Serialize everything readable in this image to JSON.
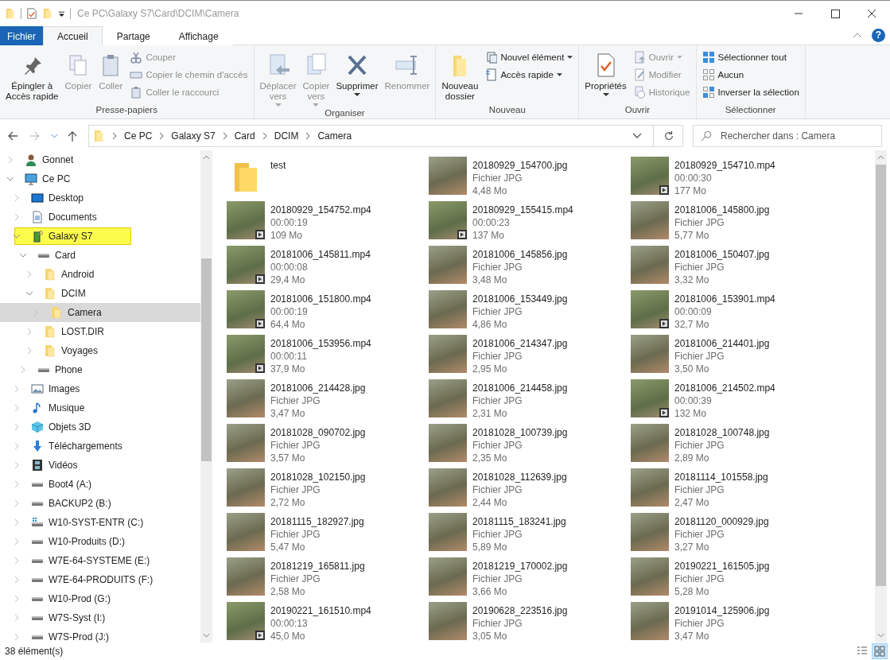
{
  "title_bar": {
    "path": "Ce PC\\Galaxy S7\\Card\\DCIM\\Camera"
  },
  "ribbon_tabs": [
    {
      "label": "Fichier",
      "kind": "file",
      "selected": false
    },
    {
      "label": "Accueil",
      "kind": "tab",
      "selected": true
    },
    {
      "label": "Partage",
      "kind": "tab",
      "selected": false
    },
    {
      "label": "Affichage",
      "kind": "tab",
      "selected": false
    }
  ],
  "help_button": "?",
  "ribbon_groups": [
    {
      "label": "Presse-papiers",
      "items": [
        {
          "label": "Épingler à\nAccès rapide",
          "kind": "large",
          "disabled": false,
          "dropdown": false
        },
        {
          "label": "Copier",
          "kind": "large",
          "disabled": true,
          "dropdown": false
        },
        {
          "label": "Coller",
          "kind": "large",
          "disabled": true,
          "dropdown": false
        },
        {
          "label": "Couper",
          "kind": "small",
          "disabled": true,
          "dropdown": false
        },
        {
          "label": "Copier le chemin d'accès",
          "kind": "small",
          "disabled": true,
          "dropdown": false
        },
        {
          "label": "Coller le raccourci",
          "kind": "small",
          "disabled": true,
          "dropdown": false
        }
      ]
    },
    {
      "label": "Organiser",
      "items": [
        {
          "label": "Déplacer\nvers",
          "kind": "large",
          "disabled": true,
          "dropdown": true
        },
        {
          "label": "Copier\nvers",
          "kind": "large",
          "disabled": true,
          "dropdown": true
        },
        {
          "label": "Supprimer",
          "kind": "large",
          "disabled": false,
          "dropdown": true
        },
        {
          "label": "Renommer",
          "kind": "large",
          "disabled": true,
          "dropdown": false
        }
      ]
    },
    {
      "label": "Nouveau",
      "items": [
        {
          "label": "Nouveau\ndossier",
          "kind": "large",
          "disabled": false,
          "dropdown": false
        },
        {
          "label": "Nouvel élément",
          "kind": "small",
          "disabled": false,
          "dropdown": true
        },
        {
          "label": "Accès rapide",
          "kind": "small",
          "disabled": false,
          "dropdown": true
        }
      ]
    },
    {
      "label": "Ouvrir",
      "items": [
        {
          "label": "Propriétés",
          "kind": "large",
          "disabled": false,
          "dropdown": true
        },
        {
          "label": "Ouvrir",
          "kind": "small",
          "disabled": true,
          "dropdown": true
        },
        {
          "label": "Modifier",
          "kind": "small",
          "disabled": true,
          "dropdown": false
        },
        {
          "label": "Historique",
          "kind": "small",
          "disabled": true,
          "dropdown": false
        }
      ]
    },
    {
      "label": "Sélectionner",
      "items": [
        {
          "label": "Sélectionner tout",
          "kind": "small",
          "disabled": false,
          "dropdown": false
        },
        {
          "label": "Aucun",
          "kind": "small",
          "disabled": false,
          "dropdown": false
        },
        {
          "label": "Inverser la sélection",
          "kind": "small",
          "disabled": false,
          "dropdown": false
        }
      ]
    }
  ],
  "address_bar": {
    "forward_disabled": true,
    "breadcrumbs": [
      "Ce PC",
      "Galaxy S7",
      "Card",
      "DCIM",
      "Camera"
    ]
  },
  "search": {
    "placeholder": "Rechercher dans : Camera"
  },
  "tree": [
    {
      "label": "Gonnet",
      "kind": "user",
      "expanded": false,
      "selected": false,
      "highlighted": false
    },
    {
      "label": "Ce PC",
      "kind": "pc",
      "expanded": true,
      "selected": false,
      "highlighted": false,
      "children": [
        {
          "label": "Desktop",
          "kind": "desktop",
          "expanded": false,
          "selected": false,
          "highlighted": false
        },
        {
          "label": "Documents",
          "kind": "documents",
          "expanded": false,
          "selected": false,
          "highlighted": false
        },
        {
          "label": "Galaxy S7",
          "kind": "phone",
          "expanded": true,
          "selected": false,
          "highlighted": true,
          "children": [
            {
              "label": "Card",
              "kind": "drive",
              "expanded": true,
              "selected": false,
              "highlighted": false,
              "children": [
                {
                  "label": "Android",
                  "kind": "folder",
                  "expanded": false,
                  "selected": false,
                  "highlighted": false
                },
                {
                  "label": "DCIM",
                  "kind": "folder",
                  "expanded": true,
                  "selected": false,
                  "highlighted": false,
                  "children": [
                    {
                      "label": "Camera",
                      "kind": "folder",
                      "expanded": false,
                      "selected": true,
                      "highlighted": false
                    }
                  ]
                },
                {
                  "label": "LOST.DIR",
                  "kind": "folder",
                  "expanded": false,
                  "selected": false,
                  "highlighted": false
                },
                {
                  "label": "Voyages",
                  "kind": "folder",
                  "expanded": false,
                  "selected": false,
                  "highlighted": false
                }
              ]
            },
            {
              "label": "Phone",
              "kind": "drive",
              "expanded": false,
              "selected": false,
              "highlighted": false
            }
          ]
        },
        {
          "label": "Images",
          "kind": "images",
          "expanded": false,
          "selected": false,
          "highlighted": false
        },
        {
          "label": "Musique",
          "kind": "music",
          "expanded": false,
          "selected": false,
          "highlighted": false
        },
        {
          "label": "Objets 3D",
          "kind": "cube",
          "expanded": false,
          "selected": false,
          "highlighted": false
        },
        {
          "label": "Téléchargements",
          "kind": "downloads",
          "expanded": false,
          "selected": false,
          "highlighted": false
        },
        {
          "label": "Vidéos",
          "kind": "videos",
          "expanded": false,
          "selected": false,
          "highlighted": false
        },
        {
          "label": "Boot4 (A:)",
          "kind": "drive",
          "expanded": false,
          "selected": false,
          "highlighted": false
        },
        {
          "label": "BACKUP2 (B:)",
          "kind": "drive",
          "expanded": false,
          "selected": false,
          "highlighted": false
        },
        {
          "label": "W10-SYST-ENTR (C:)",
          "kind": "system",
          "expanded": false,
          "selected": false,
          "highlighted": false
        },
        {
          "label": "W10-Produits (D:)",
          "kind": "drive",
          "expanded": false,
          "selected": false,
          "highlighted": false
        },
        {
          "label": "W7E-64-SYSTEME (E:)",
          "kind": "drive",
          "expanded": false,
          "selected": false,
          "highlighted": false
        },
        {
          "label": "W7E-64-PRODUITS (F:)",
          "kind": "drive",
          "expanded": false,
          "selected": false,
          "highlighted": false
        },
        {
          "label": "W10-Prod (G:)",
          "kind": "drive",
          "expanded": false,
          "selected": false,
          "highlighted": false
        },
        {
          "label": "W7S-Syst (I:)",
          "kind": "drive",
          "expanded": false,
          "selected": false,
          "highlighted": false
        },
        {
          "label": "W7S-Prod (J:)",
          "kind": "drive",
          "expanded": false,
          "selected": false,
          "highlighted": false
        }
      ]
    }
  ],
  "files": [
    {
      "name": "test",
      "kind": "folder"
    },
    {
      "name": "20180929_154700.jpg",
      "kind": "image",
      "detail": "Fichier JPG",
      "size": "4,48 Mo"
    },
    {
      "name": "20180929_154710.mp4",
      "kind": "video",
      "detail": "00:00:30",
      "size": "177 Mo"
    },
    {
      "name": "20180929_154752.mp4",
      "kind": "video",
      "detail": "00:00:19",
      "size": "109 Mo"
    },
    {
      "name": "20180929_155415.mp4",
      "kind": "video",
      "detail": "00:00:23",
      "size": "137 Mo"
    },
    {
      "name": "20181006_145800.jpg",
      "kind": "image",
      "detail": "Fichier JPG",
      "size": "5,77 Mo"
    },
    {
      "name": "20181006_145811.mp4",
      "kind": "video",
      "detail": "00:00:08",
      "size": "29,4 Mo"
    },
    {
      "name": "20181006_145856.jpg",
      "kind": "image",
      "detail": "Fichier JPG",
      "size": "3,48 Mo"
    },
    {
      "name": "20181006_150407.jpg",
      "kind": "image",
      "detail": "Fichier JPG",
      "size": "3,32 Mo"
    },
    {
      "name": "20181006_151800.mp4",
      "kind": "video",
      "detail": "00:00:19",
      "size": "64,4 Mo"
    },
    {
      "name": "20181006_153449.jpg",
      "kind": "image",
      "detail": "Fichier JPG",
      "size": "4,86 Mo"
    },
    {
      "name": "20181006_153901.mp4",
      "kind": "video",
      "detail": "00:00:09",
      "size": "32,7 Mo"
    },
    {
      "name": "20181006_153956.mp4",
      "kind": "video",
      "detail": "00:00:11",
      "size": "37,9 Mo"
    },
    {
      "name": "20181006_214347.jpg",
      "kind": "image",
      "detail": "Fichier JPG",
      "size": "2,95 Mo"
    },
    {
      "name": "20181006_214401.jpg",
      "kind": "image",
      "detail": "Fichier JPG",
      "size": "3,50 Mo"
    },
    {
      "name": "20181006_214428.jpg",
      "kind": "image",
      "detail": "Fichier JPG",
      "size": "3,47 Mo"
    },
    {
      "name": "20181006_214458.jpg",
      "kind": "image",
      "detail": "Fichier JPG",
      "size": "2,31 Mo"
    },
    {
      "name": "20181006_214502.mp4",
      "kind": "video",
      "detail": "00:00:39",
      "size": "132 Mo"
    },
    {
      "name": "20181028_090702.jpg",
      "kind": "image",
      "detail": "Fichier JPG",
      "size": "3,57 Mo"
    },
    {
      "name": "20181028_100739.jpg",
      "kind": "image",
      "detail": "Fichier JPG",
      "size": "2,35 Mo"
    },
    {
      "name": "20181028_100748.jpg",
      "kind": "image",
      "detail": "Fichier JPG",
      "size": "2,89 Mo"
    },
    {
      "name": "20181028_102150.jpg",
      "kind": "image",
      "detail": "Fichier JPG",
      "size": "2,72 Mo"
    },
    {
      "name": "20181028_112639.jpg",
      "kind": "image",
      "detail": "Fichier JPG",
      "size": "2,44 Mo"
    },
    {
      "name": "20181114_101558.jpg",
      "kind": "image",
      "detail": "Fichier JPG",
      "size": "2,47 Mo"
    },
    {
      "name": "20181115_182927.jpg",
      "kind": "image",
      "detail": "Fichier JPG",
      "size": "5,47 Mo"
    },
    {
      "name": "20181115_183241.jpg",
      "kind": "image",
      "detail": "Fichier JPG",
      "size": "5,89 Mo"
    },
    {
      "name": "20181120_000929.jpg",
      "kind": "image",
      "detail": "Fichier JPG",
      "size": "3,27 Mo"
    },
    {
      "name": "20181219_165811.jpg",
      "kind": "image",
      "detail": "Fichier JPG",
      "size": "2,58 Mo"
    },
    {
      "name": "20181219_170002.jpg",
      "kind": "image",
      "detail": "Fichier JPG",
      "size": "3,66 Mo"
    },
    {
      "name": "20190221_161505.jpg",
      "kind": "image",
      "detail": "Fichier JPG",
      "size": "5,28 Mo"
    },
    {
      "name": "20190221_161510.mp4",
      "kind": "video",
      "detail": "00:00:13",
      "size": "45,0 Mo"
    },
    {
      "name": "20190628_223516.jpg",
      "kind": "image",
      "detail": "Fichier JPG",
      "size": "3,05 Mo"
    },
    {
      "name": "20191014_125906.jpg",
      "kind": "image",
      "detail": "Fichier JPG",
      "size": "3,47 Mo"
    }
  ],
  "status_bar": {
    "count": "38 élément(s)",
    "views": [
      {
        "kind": "details",
        "selected": false
      },
      {
        "kind": "tiles",
        "selected": true
      }
    ]
  }
}
